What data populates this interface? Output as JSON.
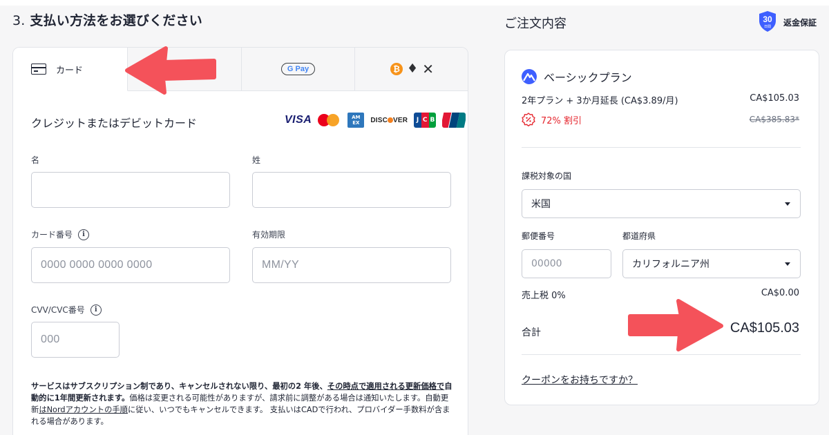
{
  "payment": {
    "section_number": "3.",
    "section_title": "支払い方法をお選びください",
    "tabs": {
      "card_label": "カード",
      "gpay_label": "G Pay"
    },
    "card_heading": "クレジットまたはデビットカード",
    "brands": {
      "visa": "VISA",
      "amex": "AM EX",
      "discover_pre": "DISC",
      "discover_post": "VER",
      "jcb": [
        "J",
        "C",
        "B"
      ]
    },
    "fields": {
      "first_name_label": "名",
      "last_name_label": "姓",
      "card_number_label": "カード番号",
      "card_number_placeholder": "0000 0000 0000 0000",
      "expiry_label": "有効期限",
      "expiry_placeholder": "MM/YY",
      "cvv_label": "CVV/CVC番号",
      "cvv_placeholder": "000",
      "info_glyph": "i"
    },
    "terms": {
      "bold_1": "サービスはサブスクリプション制であり、キャンセルされない限り、最初の2 年後、",
      "bold_underlined_1": "その時点で適用される更新価格で",
      "bold_2": "自動的に1年間更新されます。",
      "text_1": "価格は変更される可能性がありますが、請求前に調整がある場合は通知いたします。自動更新",
      "link_1": "はNordアカウントの手順",
      "text_2": "に従い、いつでもキャンセルできます。 支払いはCADで行われ、プロバイダー手数料が含まれる場合があります。"
    }
  },
  "summary": {
    "title": "ご注文内容",
    "guarantee_days": "30",
    "guarantee_unit": "日間",
    "guarantee_label": "返金保証",
    "plan_name": "ベーシックプラン",
    "plan_desc": "2年プラン + 3か月延長 (CA$3.89/月)",
    "plan_price": "CA$105.03",
    "discount_label": "72% 割引",
    "original_price": "CA$385.83*",
    "country_label": "課税対象の国",
    "country_value": "米国",
    "zip_label": "郵便番号",
    "zip_placeholder": "00000",
    "state_label": "都道府県",
    "state_value": "カリフォルニア州",
    "tax_label": "売上税 0%",
    "tax_value": "CA$0.00",
    "total_label": "合計",
    "total_value": "CA$105.03",
    "coupon_link": "クーポンをお持ちですか？"
  },
  "colors": {
    "accent_blue": "#3e5fff",
    "discount_red": "#e5262e",
    "annotation_arrow": "#f4525a"
  }
}
